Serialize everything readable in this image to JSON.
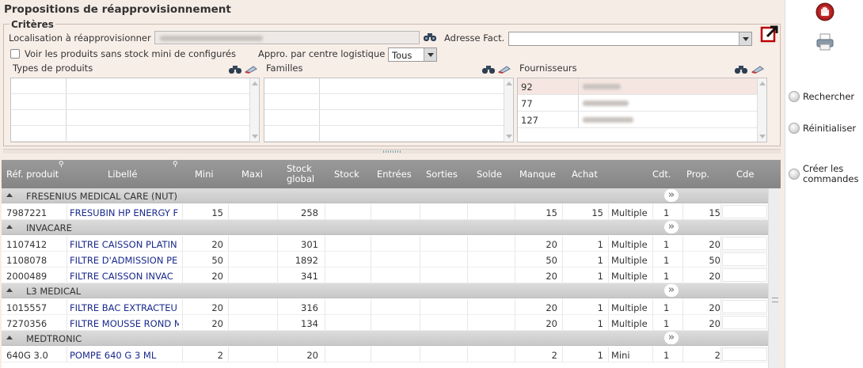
{
  "page": {
    "title": "Propositions de réapprovisionnement"
  },
  "criteria": {
    "legend": "Critères",
    "location_label": "Localisation à réapprovisionner",
    "address_label": "Adresse Fact.",
    "checkbox_label": "Voir les produits sans stock mini de configurés",
    "appro_label": "Appro. par centre logistique",
    "appro_value": "Tous",
    "types_label": "Types de produits",
    "familles_label": "Familles",
    "fournisseurs_label": "Fournisseurs",
    "fournisseurs": [
      {
        "id": "92"
      },
      {
        "id": "77"
      },
      {
        "id": "127"
      }
    ]
  },
  "grid": {
    "headers": {
      "ref": "Réf. produit",
      "libelle": "Libellé",
      "mini": "Mini",
      "maxi": "Maxi",
      "stock_global_1": "Stock",
      "stock_global_2": "global",
      "stock": "Stock",
      "entrees": "Entrées",
      "sorties": "Sorties",
      "solde": "Solde",
      "manque": "Manque",
      "achat": "Achat",
      "cdt": "Cdt.",
      "prop": "Prop.",
      "cde": "Cde"
    },
    "groups": [
      {
        "name": "FRESENIUS MEDICAL CARE (NUT)",
        "rows": [
          {
            "ref": "7987221",
            "lib": "FRESUBIN HP ENERGY F",
            "mini": "15",
            "sg": "258",
            "manque": "15",
            "achat": "15",
            "unit": "Multiple",
            "cdt": "1",
            "prop": "15"
          }
        ]
      },
      {
        "name": "INVACARE",
        "rows": [
          {
            "ref": "1107412",
            "lib": "FILTRE CAISSON PLATIN",
            "mini": "20",
            "sg": "301",
            "manque": "20",
            "achat": "1",
            "unit": "Multiple",
            "cdt": "1",
            "prop": "20"
          },
          {
            "ref": "1108078",
            "lib": "FILTRE D'ADMISSION PE",
            "mini": "50",
            "sg": "1892",
            "manque": "50",
            "achat": "1",
            "unit": "Multiple",
            "cdt": "1",
            "prop": "50"
          },
          {
            "ref": "2000489",
            "lib": "FILTRE CAISSON INVAC",
            "mini": "20",
            "sg": "341",
            "manque": "20",
            "achat": "1",
            "unit": "Multiple",
            "cdt": "1",
            "prop": "20"
          }
        ]
      },
      {
        "name": "L3 MEDICAL",
        "rows": [
          {
            "ref": "1015557",
            "lib": "FILTRE BAC EXTRACTEU",
            "mini": "20",
            "sg": "316",
            "manque": "20",
            "achat": "1",
            "unit": "Multiple",
            "cdt": "1",
            "prop": "20"
          },
          {
            "ref": "7270356",
            "lib": "FILTRE MOUSSE ROND M",
            "mini": "20",
            "sg": "134",
            "manque": "20",
            "achat": "1",
            "unit": "Multiple",
            "cdt": "1",
            "prop": "20"
          }
        ]
      },
      {
        "name": "MEDTRONIC",
        "rows": [
          {
            "ref": "640G 3.0",
            "lib": "POMPE 640 G 3 ML",
            "mini": "2",
            "sg": "20",
            "manque": "2",
            "achat": "1",
            "unit": "Mini",
            "cdt": "1",
            "prop": "2"
          }
        ]
      }
    ]
  },
  "actions": {
    "search": "Rechercher",
    "reset": "Réinitialiser",
    "create_1": "Créer les",
    "create_2": "commandes"
  }
}
